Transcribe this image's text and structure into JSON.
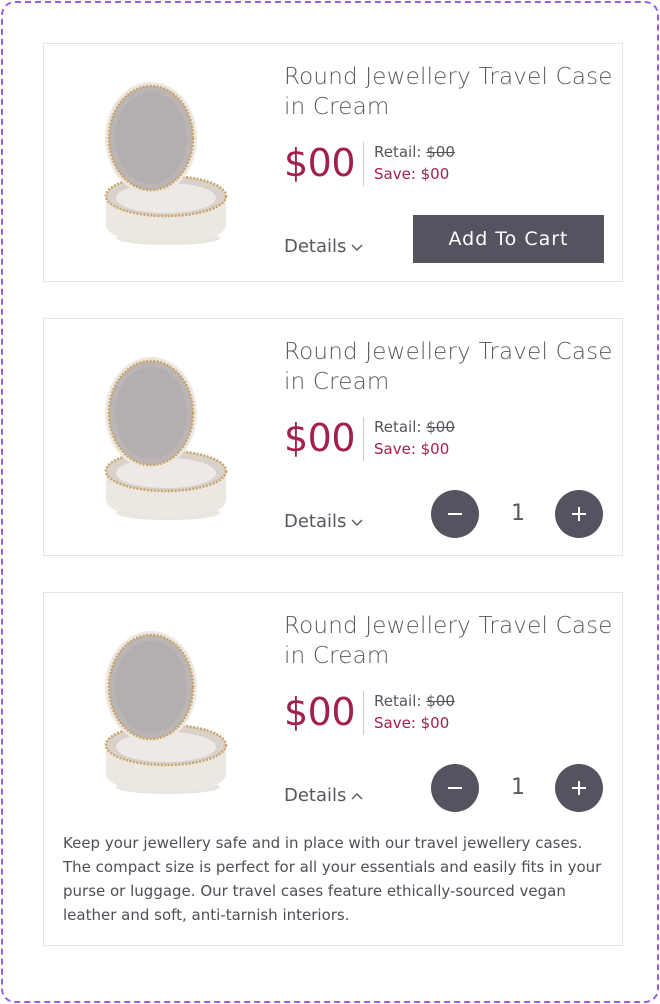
{
  "products": [
    {
      "title": "Round Jewellery Travel Case in Cream",
      "price": "$00",
      "retail_label": "Retail:",
      "retail_value": "$00",
      "save_label": "Save: $00",
      "details_label": "Details",
      "details_icon": "chevron-down-icon",
      "action": "add-to-cart",
      "add_to_cart_label": "Add To Cart"
    },
    {
      "title": "Round Jewellery Travel Case in Cream",
      "price": "$00",
      "retail_label": "Retail:",
      "retail_value": "$00",
      "save_label": "Save: $00",
      "details_label": "Details",
      "details_icon": "chevron-down-icon",
      "action": "quantity-stepper",
      "quantity": "1"
    },
    {
      "title": "Round Jewellery Travel Case in Cream",
      "price": "$00",
      "retail_label": "Retail:",
      "retail_value": "$00",
      "save_label": "Save: $00",
      "details_label": "Details",
      "details_icon": "chevron-up-icon",
      "action": "quantity-stepper",
      "quantity": "1",
      "description": "Keep your jewellery safe and in place with our travel jewellery cases. The compact size is perfect for all your essentials and easily fits in your purse or luggage. Our travel cases feature ethically-sourced vegan leather and soft, anti-tarnish interiors."
    }
  ],
  "colors": {
    "price": "#a3204b",
    "button": "#54535f",
    "text": "#5a5660",
    "border": "#e8e3dc",
    "frame": "#9b5de5"
  }
}
